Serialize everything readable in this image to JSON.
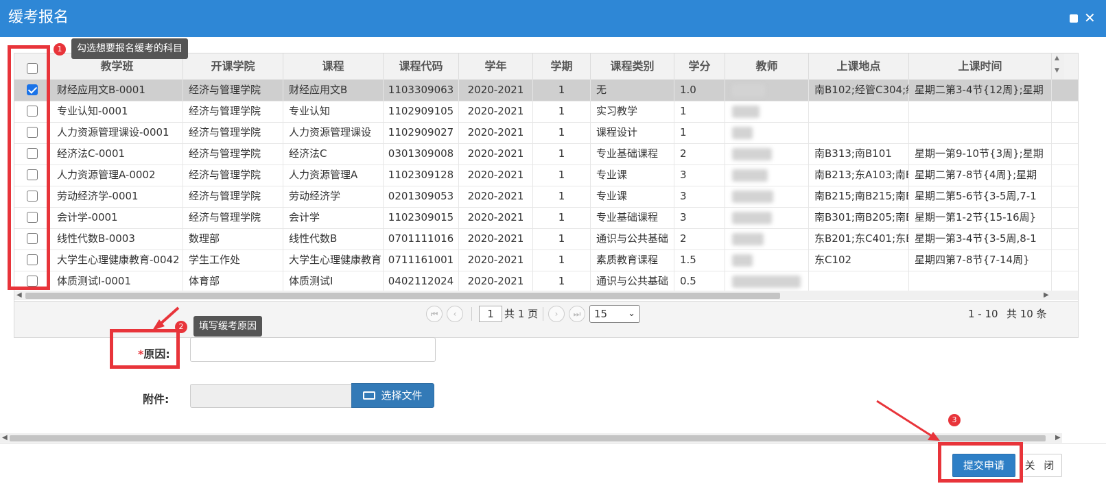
{
  "dialog": {
    "title": "缓考报名",
    "accent_color": "#2e87d6"
  },
  "table": {
    "columns": [
      "教学班",
      "开课学院",
      "课程",
      "课程代码",
      "学年",
      "学期",
      "课程类别",
      "学分",
      "教师",
      "上课地点",
      "上课时间"
    ],
    "rows": [
      {
        "checked": true,
        "class": "财经应用文B-0001",
        "college": "经济与管理学院",
        "course": "财经应用文B",
        "code": "1103309063",
        "year": "2020-2021",
        "term": "1",
        "type": "无",
        "credit": "1.0",
        "location": "南B102;经管C304;经",
        "time": "星期二第3-4节{12周};星期"
      },
      {
        "checked": false,
        "class": "专业认知-0001",
        "college": "经济与管理学院",
        "course": "专业认知",
        "code": "1102909105",
        "year": "2020-2021",
        "term": "1",
        "type": "实习教学",
        "credit": "1",
        "location": "",
        "time": ""
      },
      {
        "checked": false,
        "class": "人力资源管理课设-0001",
        "college": "经济与管理学院",
        "course": "人力资源管理课设",
        "code": "1102909027",
        "year": "2020-2021",
        "term": "1",
        "type": "课程设计",
        "credit": "1",
        "location": "",
        "time": ""
      },
      {
        "checked": false,
        "class": "经济法C-0001",
        "college": "经济与管理学院",
        "course": "经济法C",
        "code": "0301309008",
        "year": "2020-2021",
        "term": "1",
        "type": "专业基础课程",
        "credit": "2",
        "location": "南B313;南B101",
        "time": "星期一第9-10节{3周};星期"
      },
      {
        "checked": false,
        "class": "人力资源管理A-0002",
        "college": "经济与管理学院",
        "course": "人力资源管理A",
        "code": "1102309128",
        "year": "2020-2021",
        "term": "1",
        "type": "专业课",
        "credit": "3",
        "location": "南B213;东A103;南B",
        "time": "星期二第7-8节{4周};星期"
      },
      {
        "checked": false,
        "class": "劳动经济学-0001",
        "college": "经济与管理学院",
        "course": "劳动经济学",
        "code": "0201309053",
        "year": "2020-2021",
        "term": "1",
        "type": "专业课",
        "credit": "3",
        "location": "南B215;南B215;南B",
        "time": "星期二第5-6节{3-5周,7-1"
      },
      {
        "checked": false,
        "class": "会计学-0001",
        "college": "经济与管理学院",
        "course": "会计学",
        "code": "1102309015",
        "year": "2020-2021",
        "term": "1",
        "type": "专业基础课程",
        "credit": "3",
        "location": "南B301;南B205;南B",
        "time": "星期一第1-2节{15-16周}"
      },
      {
        "checked": false,
        "class": "线性代数B-0003",
        "college": "数理部",
        "course": "线性代数B",
        "code": "0701111016",
        "year": "2020-2021",
        "term": "1",
        "type": "通识与公共基础",
        "credit": "2",
        "location": "东B201;东C401;东B",
        "time": "星期一第3-4节{3-5周,8-1"
      },
      {
        "checked": false,
        "class": "大学生心理健康教育-0042",
        "college": "学生工作处",
        "course": "大学生心理健康教育",
        "code": "0711161001",
        "year": "2020-2021",
        "term": "1",
        "type": "素质教育课程",
        "credit": "1.5",
        "location": "东C102",
        "time": "星期四第7-8节{7-14周}"
      },
      {
        "checked": false,
        "class": "体质测试Ⅰ-0001",
        "college": "体育部",
        "course": "体质测试Ⅰ",
        "code": "0402112024",
        "year": "2020-2021",
        "term": "1",
        "type": "通识与公共基础",
        "credit": "0.5",
        "location": "",
        "time": ""
      }
    ]
  },
  "pager": {
    "page": "1",
    "total_pages_text": "共 1 页",
    "page_size": "15",
    "range_text": "1 - 10",
    "total_text": "共 10 条"
  },
  "annotations": {
    "tip1": "勾选想要报名缓考的科目",
    "tip2": "填写缓考原因",
    "badge1": "1",
    "badge2": "2",
    "badge3": "3",
    "highlight_color": "#e8343a"
  },
  "form": {
    "reason_required": "*",
    "reason_label": "原因:",
    "attachment_label": "附件:",
    "choose_file_label": "选择文件"
  },
  "footer": {
    "submit_label": "提交申请",
    "close_label": "关 闭"
  }
}
